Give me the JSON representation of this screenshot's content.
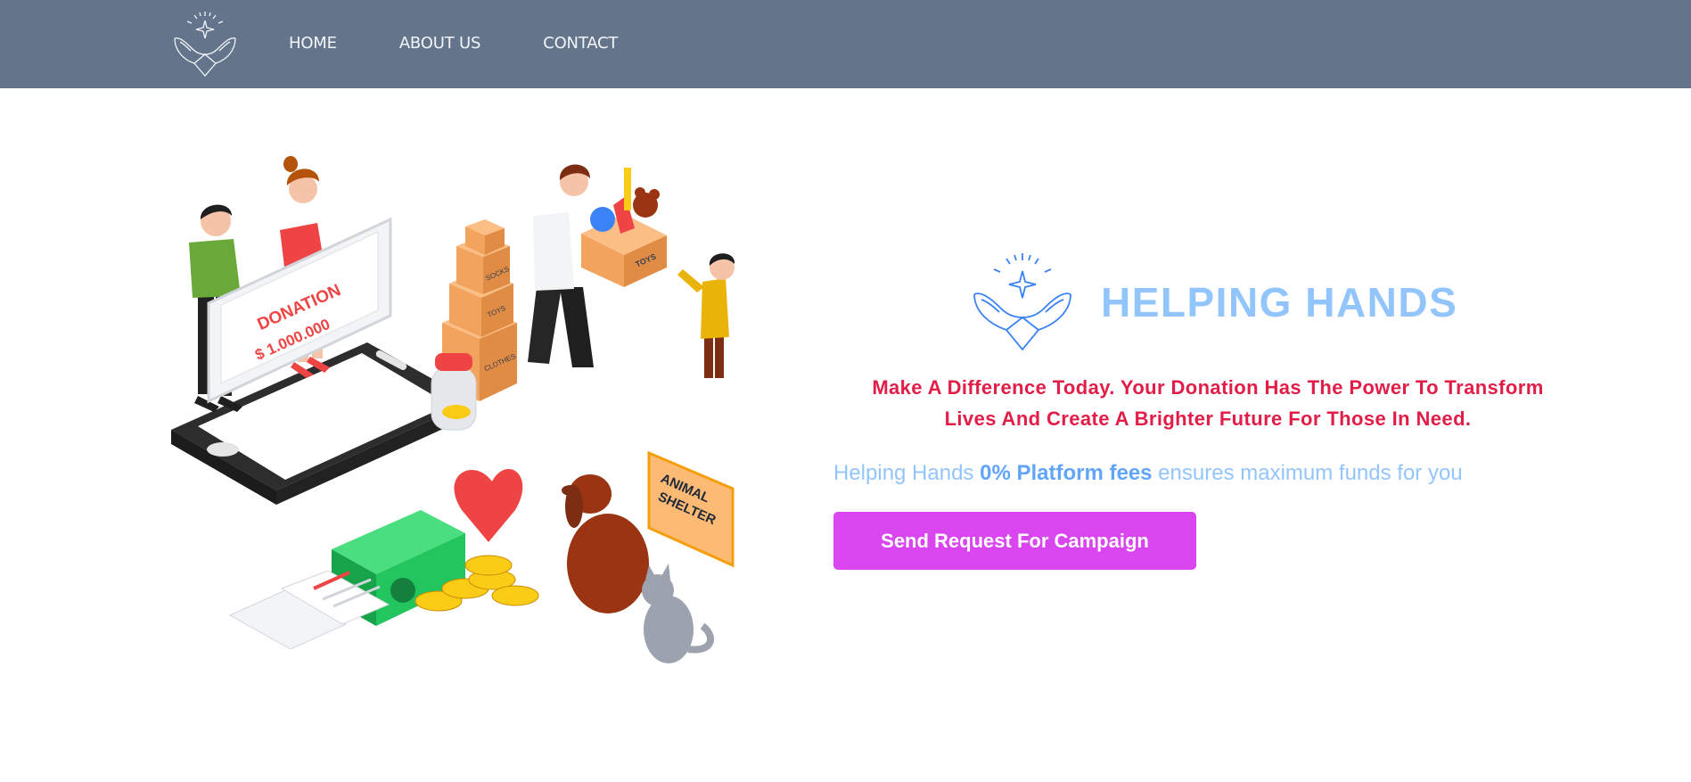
{
  "nav": {
    "logo_icon": "helping-hands-logo-icon",
    "links": [
      "HOME",
      "ABOUT US",
      "CONTACT"
    ]
  },
  "hero": {
    "illustration_icon": "donation-illustration",
    "illustration_text": {
      "check_title": "DONATION",
      "check_amount": "$ 1.000.000",
      "box_socks": "SOCKS",
      "box_toys_small": "TOYS",
      "box_clothes": "CLOTHES",
      "box_toys": "TOYS",
      "sign": [
        "ANIMAL",
        "SHELTER"
      ]
    },
    "brand_icon": "helping-hands-logo-icon",
    "brand_title": "HELPING HANDS",
    "tagline_line1": "Make A Difference Today. Your Donation Has The Power To Transform",
    "tagline_line2": "Lives And Create A Brighter Future For Those In Need.",
    "fees_prefix": "Helping Hands ",
    "fees_strong": "0% Platform fees",
    "fees_suffix": " ensures maximum funds for you",
    "cta_label": "Send Request For Campaign"
  },
  "colors": {
    "navbar": "#64748b",
    "brand_title": "#93c5fd",
    "tagline": "#e11d48",
    "fees_text": "#93c5fd",
    "fees_strong": "#60a5fa",
    "cta_background": "#d946ef"
  }
}
